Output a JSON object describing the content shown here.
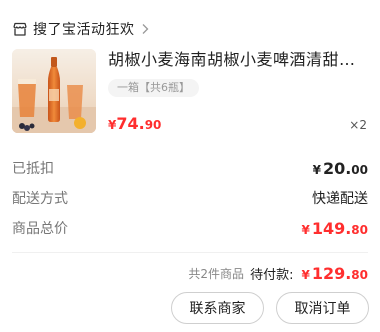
{
  "shop": {
    "name": "搜了宝活动狂欢"
  },
  "product": {
    "title": "胡椒小麦海南胡椒小麦啤酒清甜…",
    "spec": "一箱【共6瓶】",
    "price": {
      "currency": "¥",
      "int": "74.",
      "dec": "90"
    },
    "quantity": "×2"
  },
  "summary": {
    "discount": {
      "label": "已抵扣",
      "currency": "¥",
      "int": "20.",
      "dec": "00"
    },
    "shipping": {
      "label": "配送方式",
      "value": "快递配送"
    },
    "goods_total": {
      "label": "商品总价",
      "currency": "¥",
      "int": "149.",
      "dec": "80"
    }
  },
  "footer": {
    "count_text": "共2件商品",
    "pay_label": "待付款:",
    "pay": {
      "currency": "¥",
      "int": "129.",
      "dec": "80"
    }
  },
  "actions": {
    "contact_label": "联系商家",
    "cancel_label": "取消订单"
  },
  "colors": {
    "accent": "#ff2e2e",
    "text": "#222222",
    "muted": "#777777"
  }
}
